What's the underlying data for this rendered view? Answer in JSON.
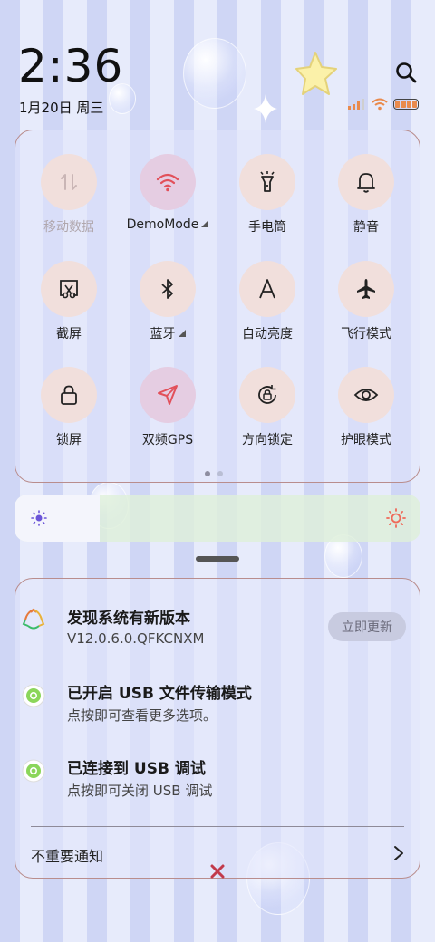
{
  "status_bar": {
    "time": "2:36",
    "date": "1月20日 周三"
  },
  "quick_settings": {
    "tiles": [
      {
        "label": "移动数据",
        "icon": "mobile-data-icon",
        "state": "disabled"
      },
      {
        "label": "DemoMode",
        "icon": "wifi-icon",
        "state": "active"
      },
      {
        "label": "手电筒",
        "icon": "flashlight-icon",
        "state": "off"
      },
      {
        "label": "静音",
        "icon": "bell-icon",
        "state": "off"
      },
      {
        "label": "截屏",
        "icon": "screenshot-icon",
        "state": "off"
      },
      {
        "label": "蓝牙",
        "icon": "bluetooth-icon",
        "state": "off"
      },
      {
        "label": "自动亮度",
        "icon": "auto-brightness-icon",
        "state": "off"
      },
      {
        "label": "飞行模式",
        "icon": "airplane-icon",
        "state": "off"
      },
      {
        "label": "锁屏",
        "icon": "lock-icon",
        "state": "off"
      },
      {
        "label": "双频GPS",
        "icon": "gps-icon",
        "state": "active"
      },
      {
        "label": "方向锁定",
        "icon": "rotation-lock-icon",
        "state": "off"
      },
      {
        "label": "护眼模式",
        "icon": "eye-icon",
        "state": "off"
      }
    ],
    "page_count": 2,
    "current_page": 1
  },
  "brightness": {
    "level": 0.21
  },
  "notifications": [
    {
      "title": "发现系统有新版本",
      "subtitle": "V12.0.6.0.QFKCNXM",
      "action": "立即更新",
      "icon": "update-icon"
    },
    {
      "title": "已开启 USB 文件传输模式",
      "subtitle": "点按即可查看更多选项。",
      "icon": "android-settings-icon"
    },
    {
      "title": "已连接到 USB 调试",
      "subtitle": "点按即可关闭 USB 调试",
      "icon": "android-settings-icon"
    }
  ],
  "footer": {
    "unimportant_label": "不重要通知"
  },
  "colors": {
    "tile_bg": "#f1dfdc",
    "tile_active_bg": "#e5cde2",
    "wifi_accent": "#e2505a",
    "gps_accent": "#e2505a"
  }
}
